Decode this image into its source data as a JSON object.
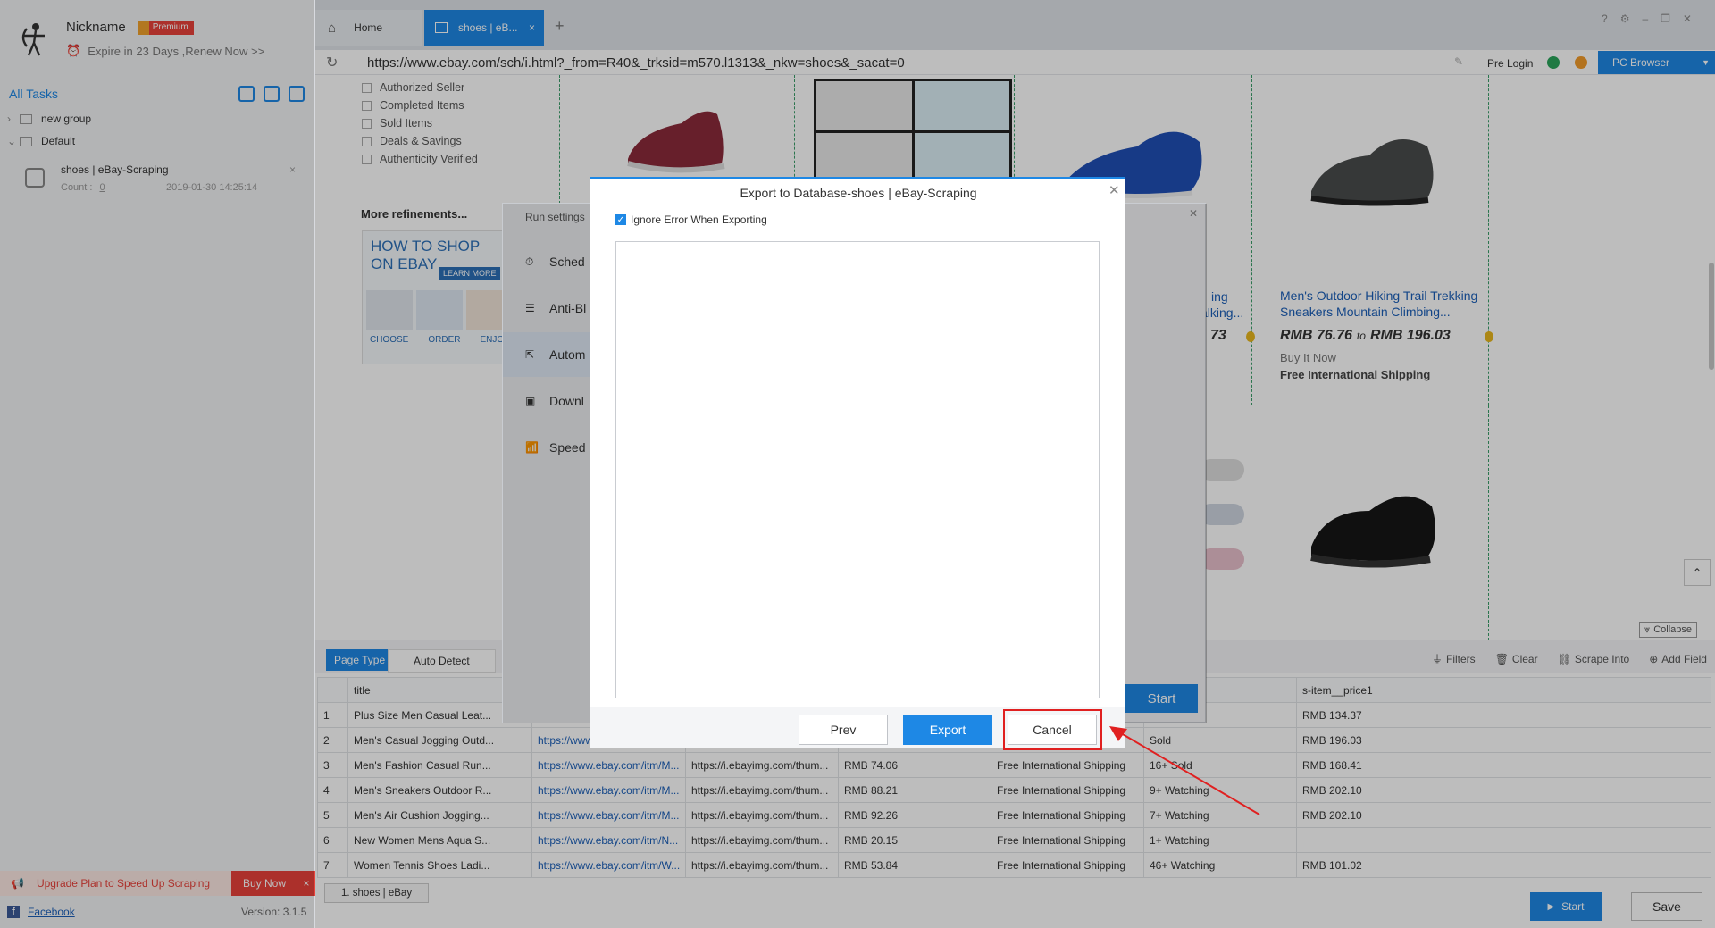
{
  "sidebar": {
    "nickname": "Nickname",
    "premium_badge": "Premium",
    "expire_text": "Expire in 23 Days ,Renew Now >>",
    "all_tasks": "All Tasks",
    "groups": [
      {
        "label": "new group"
      },
      {
        "label": "Default"
      }
    ],
    "task": {
      "name": "shoes | eBay-Scraping",
      "count_label": "Count :",
      "count_value": "0",
      "timestamp": "2019-01-30 14:25:14"
    },
    "upgrade_text": "Upgrade Plan to Speed Up Scraping",
    "buy_now": "Buy Now",
    "facebook": "Facebook",
    "version": "Version: 3.1.5"
  },
  "tabs": [
    {
      "label": "Home"
    },
    {
      "label": "shoes | eB..."
    }
  ],
  "address": {
    "url": "https://www.ebay.com/sch/i.html?_from=R40&_trksid=m570.l1313&_nkw=shoes&_sacat=0",
    "pre_login": "Pre Login",
    "pc_browser": "PC Browser"
  },
  "ebay": {
    "filters": [
      "Authorized Seller",
      "Completed Items",
      "Sold Items",
      "Deals & Savings",
      "Authenticity Verified"
    ],
    "more_refinements": "More refinements...",
    "howto_line1": "HOW TO SHOP",
    "howto_line2": "ON EBAY",
    "learn_more": "LEARN MORE",
    "howto_steps": [
      "CHOOSE",
      "ORDER",
      "ENJOY"
    ],
    "partial_title1": "ing",
    "partial_title2": "alking...",
    "partial_price": "73",
    "product_title": "Men's Outdoor Hiking Trail Trekking Sneakers Mountain Climbing...",
    "product_price_a": "RMB 76.76",
    "product_price_to": "to",
    "product_price_b": "RMB 196.03",
    "product_buy": "Buy It Now",
    "product_shipping": "Free International Shipping"
  },
  "run_settings": {
    "title": "Run settings",
    "items": [
      {
        "label": "Sched"
      },
      {
        "label": "Anti-Bl"
      },
      {
        "label": "Autom"
      },
      {
        "label": "Downl"
      },
      {
        "label": "Speed"
      }
    ],
    "start": "Start"
  },
  "bottom": {
    "page_type": "Page Type",
    "auto_detect": "Auto Detect",
    "tools": [
      "Filters",
      "Clear",
      "Scrape Into",
      "Add Field"
    ],
    "collapse": "Collapse",
    "columns": [
      "title",
      "",
      "",
      "",
      "",
      "",
      "s-item__price1"
    ],
    "rows": [
      {
        "n": "1",
        "title": "Plus Size Men Casual Leat...",
        "link": "",
        "img": "",
        "price": "",
        "ship": "",
        "watch": "",
        "price1": "RMB 134.37"
      },
      {
        "n": "2",
        "title": "Men's Casual Jogging Outd...",
        "link": "https://www.ebay.",
        "img": "",
        "price": "",
        "ship": "",
        "watch": "Sold",
        "price1": "RMB 196.03"
      },
      {
        "n": "3",
        "title": "Men's Fashion Casual Run...",
        "link": "https://www.ebay.com/itm/M...",
        "img": "https://i.ebayimg.com/thum...",
        "price": "RMB 74.06",
        "ship": "Free International Shipping",
        "watch": "16+ Sold",
        "price1": "RMB 168.41"
      },
      {
        "n": "4",
        "title": "Men's Sneakers Outdoor R...",
        "link": "https://www.ebay.com/itm/M...",
        "img": "https://i.ebayimg.com/thum...",
        "price": "RMB 88.21",
        "ship": "Free International Shipping",
        "watch": "9+ Watching",
        "price1": "RMB 202.10"
      },
      {
        "n": "5",
        "title": "Men's Air Cushion Jogging...",
        "link": "https://www.ebay.com/itm/M...",
        "img": "https://i.ebayimg.com/thum...",
        "price": "RMB 92.26",
        "ship": "Free International Shipping",
        "watch": "7+ Watching",
        "price1": "RMB 202.10"
      },
      {
        "n": "6",
        "title": "New Women Mens Aqua S...",
        "link": "https://www.ebay.com/itm/N...",
        "img": "https://i.ebayimg.com/thum...",
        "price": "RMB 20.15",
        "ship": "Free International Shipping",
        "watch": "1+ Watching",
        "price1": ""
      },
      {
        "n": "7",
        "title": "Women Tennis Shoes Ladi...",
        "link": "https://www.ebay.com/itm/W...",
        "img": "https://i.ebayimg.com/thum...",
        "price": "RMB 53.84",
        "ship": "Free International Shipping",
        "watch": "46+ Watching",
        "price1": "RMB 101.02"
      }
    ],
    "page_tab": "1.  shoes | eBay",
    "start": "Start",
    "save": "Save"
  },
  "dialog": {
    "title": "Export to Database-shoes | eBay-Scraping",
    "ignore_error": "Ignore Error When Exporting",
    "ignore_checked": true,
    "prev": "Prev",
    "export": "Export",
    "cancel": "Cancel"
  },
  "colors": {
    "accent": "#1e88e5",
    "highlight_red": "#e02020",
    "premium_red": "#e8423b"
  }
}
